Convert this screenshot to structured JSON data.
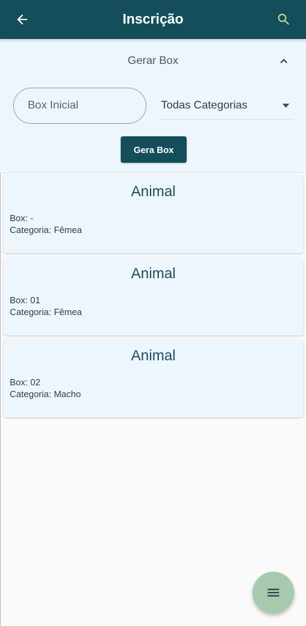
{
  "appbar": {
    "title": "Inscrição",
    "back_icon": "arrow-left-icon",
    "search_icon": "search-icon",
    "background": "#134e5a"
  },
  "generator": {
    "header_label": "Gerar Box",
    "collapse_icon": "chevron-up-icon",
    "box_input": {
      "placeholder": "Box Inicial",
      "value": ""
    },
    "category_select": {
      "selected": "Todas Categorias",
      "caret_icon": "caret-down-icon"
    },
    "button_label": "Gera Box"
  },
  "cards": [
    {
      "title": "Animal",
      "box_line": "Box: -",
      "category_line": "Categoria: Fêmea"
    },
    {
      "title": "Animal",
      "box_line": "Box: 01",
      "category_line": "Categoria: Fêmea"
    },
    {
      "title": "Animal",
      "box_line": "Box: 02",
      "category_line": "Categoria: Macho"
    }
  ],
  "fab": {
    "icon": "menu-icon",
    "color": "#a8c9ab"
  }
}
